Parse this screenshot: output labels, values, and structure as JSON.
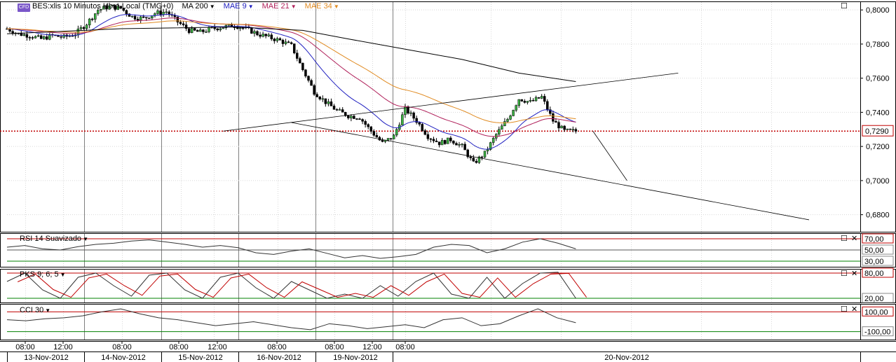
{
  "header": {
    "badge": "CFD",
    "instrument": "BES:xlis 10 Minutos Hora Local (TMG+0)",
    "ma200": "MA 200",
    "mae9": "MAE 9",
    "mae21": "MAE 21",
    "mae34": "MAE 34"
  },
  "colors": {
    "ma200": "#000000",
    "mae9": "#2020c0",
    "mae21": "#b0205a",
    "mae34": "#e08a20",
    "overbought": "#c00000",
    "oversold": "#008000",
    "current_price_line": "#c00000"
  },
  "panels": {
    "rsi": "RSI 14 Suavizado",
    "pks": "PKS 9; 6; 5",
    "cci": "CCI 30"
  },
  "icons": {
    "maximize": "maximize-icon",
    "close": "close-icon"
  },
  "chart_data": [
    {
      "type": "candlestick",
      "title": "BES:xlis 10 Minutos Hora Local (TMG+0)",
      "ylim": [
        0.67,
        0.805
      ],
      "yticks": [
        "0,8000",
        "0,7800",
        "0,7600",
        "0,7400",
        "0,7200",
        "0,7000",
        "0,6800"
      ],
      "yticks_values": [
        0.8,
        0.78,
        0.76,
        0.74,
        0.72,
        0.7,
        0.68
      ],
      "current_price": "0,7290",
      "current_price_value": 0.729,
      "x_time_labels": [
        "08:00",
        "12:00",
        "08:00",
        "08:00",
        "12:00",
        "08:00",
        "08:00",
        "12:00",
        "08:00"
      ],
      "x_date_labels": [
        "13-Nov-2012",
        "14-Nov-2012",
        "15-Nov-2012",
        "16-Nov-2012",
        "19-Nov-2012",
        "20-Nov-2012"
      ],
      "close_path": [
        {
          "x": 0,
          "y": 0.789
        },
        {
          "x": 2,
          "y": 0.786
        },
        {
          "x": 4,
          "y": 0.785
        },
        {
          "x": 6,
          "y": 0.783
        },
        {
          "x": 8,
          "y": 0.785
        },
        {
          "x": 10,
          "y": 0.784
        },
        {
          "x": 12,
          "y": 0.786
        },
        {
          "x": 14,
          "y": 0.792
        },
        {
          "x": 16,
          "y": 0.8
        },
        {
          "x": 18,
          "y": 0.802
        },
        {
          "x": 20,
          "y": 0.801
        },
        {
          "x": 22,
          "y": 0.796
        },
        {
          "x": 24,
          "y": 0.795
        },
        {
          "x": 26,
          "y": 0.798
        },
        {
          "x": 28,
          "y": 0.799
        },
        {
          "x": 30,
          "y": 0.793
        },
        {
          "x": 32,
          "y": 0.788
        },
        {
          "x": 34,
          "y": 0.787
        },
        {
          "x": 36,
          "y": 0.789
        },
        {
          "x": 38,
          "y": 0.79
        },
        {
          "x": 40,
          "y": 0.791
        },
        {
          "x": 42,
          "y": 0.789
        },
        {
          "x": 44,
          "y": 0.786
        },
        {
          "x": 46,
          "y": 0.784
        },
        {
          "x": 48,
          "y": 0.782
        },
        {
          "x": 50,
          "y": 0.779
        },
        {
          "x": 52,
          "y": 0.765
        },
        {
          "x": 54,
          "y": 0.752
        },
        {
          "x": 56,
          "y": 0.746
        },
        {
          "x": 58,
          "y": 0.741
        },
        {
          "x": 60,
          "y": 0.738
        },
        {
          "x": 62,
          "y": 0.737
        },
        {
          "x": 64,
          "y": 0.729
        },
        {
          "x": 66,
          "y": 0.722
        },
        {
          "x": 68,
          "y": 0.726
        },
        {
          "x": 70,
          "y": 0.742
        },
        {
          "x": 72,
          "y": 0.735
        },
        {
          "x": 74,
          "y": 0.726
        },
        {
          "x": 76,
          "y": 0.722
        },
        {
          "x": 78,
          "y": 0.724
        },
        {
          "x": 80,
          "y": 0.72
        },
        {
          "x": 82,
          "y": 0.71
        },
        {
          "x": 84,
          "y": 0.716
        },
        {
          "x": 86,
          "y": 0.727
        },
        {
          "x": 88,
          "y": 0.736
        },
        {
          "x": 90,
          "y": 0.748
        },
        {
          "x": 92,
          "y": 0.746
        },
        {
          "x": 94,
          "y": 0.749
        },
        {
          "x": 96,
          "y": 0.735
        },
        {
          "x": 98,
          "y": 0.729
        },
        {
          "x": 100,
          "y": 0.729
        }
      ],
      "ma200_path": [
        {
          "x": 0,
          "y": 0.786
        },
        {
          "x": 20,
          "y": 0.789
        },
        {
          "x": 40,
          "y": 0.79
        },
        {
          "x": 52,
          "y": 0.788
        },
        {
          "x": 60,
          "y": 0.783
        },
        {
          "x": 70,
          "y": 0.777
        },
        {
          "x": 80,
          "y": 0.771
        },
        {
          "x": 90,
          "y": 0.763
        },
        {
          "x": 100,
          "y": 0.758
        }
      ],
      "trendlines": [
        {
          "x1": 38,
          "y1": 0.729,
          "x2": 118,
          "y2": 0.763
        },
        {
          "x1": 50,
          "y1": 0.734,
          "x2": 141,
          "y2": 0.677
        },
        {
          "x1": 103,
          "y1": 0.729,
          "x2": 109,
          "y2": 0.7
        }
      ]
    },
    {
      "type": "line",
      "title": "RSI 14 Suavizado",
      "ylim": [
        20,
        80
      ],
      "yticks": [
        "70,00",
        "50,00",
        "30,00"
      ],
      "levels": [
        70,
        50,
        30
      ],
      "values": [
        55,
        58,
        52,
        50,
        56,
        60,
        62,
        66,
        68,
        64,
        60,
        55,
        58,
        54,
        45,
        42,
        48,
        52,
        44,
        36,
        40,
        35,
        38,
        42,
        55,
        60,
        58,
        45,
        52,
        64,
        70,
        62,
        52
      ]
    },
    {
      "type": "line",
      "title": "PKS 9; 6; 5",
      "ylim": [
        10,
        90
      ],
      "yticks": [
        "80,00",
        "20,00"
      ],
      "levels": [
        80,
        20
      ],
      "values": [
        60,
        80,
        40,
        20,
        70,
        80,
        50,
        25,
        75,
        80,
        40,
        20,
        70,
        80,
        45,
        20,
        60,
        40,
        20,
        30,
        20,
        50,
        25,
        60,
        80,
        30,
        20,
        70,
        20,
        55,
        80,
        82,
        20
      ]
    },
    {
      "type": "line",
      "title": "CCI 30",
      "ylim": [
        -180,
        180
      ],
      "yticks": [
        "100,00",
        "-100,00"
      ],
      "levels": [
        100,
        -100
      ],
      "values": [
        20,
        10,
        30,
        40,
        60,
        100,
        130,
        80,
        40,
        20,
        -10,
        -40,
        -20,
        0,
        -30,
        -60,
        -80,
        -20,
        -40,
        -70,
        -50,
        -30,
        -60,
        20,
        40,
        -40,
        -20,
        60,
        130,
        40,
        -10
      ]
    }
  ]
}
